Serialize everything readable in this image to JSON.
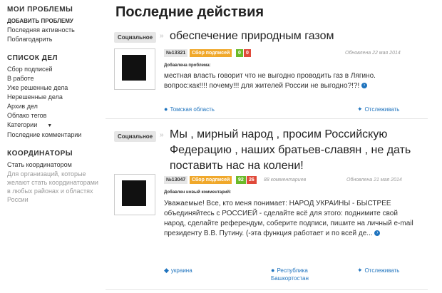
{
  "sidebar": {
    "sections": [
      {
        "heading": "Мои проблемы",
        "links": [
          "добавить проблему",
          "Последняя активность",
          "Поблагодарить"
        ]
      },
      {
        "heading": "Список дел",
        "links": [
          "Сбор подписей",
          "В работе",
          "Уже решенные дела",
          "Нерешенные дела",
          "Архив дел",
          "Облако тегов",
          "Категории",
          "Последние комментарии"
        ]
      },
      {
        "heading": "Координаторы",
        "links": [
          "Стать координатором"
        ],
        "note": "Для организаций, которые желают стать координаторами в любых районах и областях России"
      }
    ]
  },
  "main": {
    "title": "Последние действия",
    "cards": [
      {
        "category": "Социальное",
        "headline": "обеспечение природным газом",
        "number": "№13321",
        "status": "Сбор подписей",
        "votes_up": "0",
        "votes_down": "0",
        "comments": "",
        "date": "Обновлена 22 мая 2014",
        "added_label": "Добавлена проблема:",
        "text": "местная власть говорит что не выгодно проводить газ в Лягино. вопрос:как!!!! почему!!! для жителей России не выгодно?!?!",
        "location_left": "Томская область",
        "location_right": "",
        "track": "Отслеживать"
      },
      {
        "category": "Социальное",
        "headline": "Мы , мирный народ , просим Российскую Федерацию , наших братьев-славян , не дать поставить нас на колени!",
        "number": "№13047",
        "status": "Сбор подписей",
        "votes_up": "92",
        "votes_down": "26",
        "comments": "88 комментариев",
        "date": "Обновлена 21 мая 2014",
        "added_label": "Добавлен новый комментарий:",
        "text": "Уважаемые! Все, кто меня понимает: НАРОД УКРАИНЫ - БЫСТРЕЕ объединяйтесь с РОССИЕЙ - сделайте всё для этого: поднимите свой народ, сделайте референдум, соберите подписи, пишите на личный e-mail президенту В.В. Путину. (-эта функция работает и по всей де...",
        "location_left": "украина",
        "location_right": "Республика Башкортостан",
        "track": "Отслеживать"
      }
    ]
  },
  "colors": {
    "accent": "#1e73be",
    "status_orange": "#f0a82b",
    "vote_green": "#6bba2a",
    "vote_red": "#e04a3a"
  },
  "icons": {
    "pin": "map-pin-icon",
    "tag": "tag-icon",
    "track": "pushpin-icon",
    "more": "arrow-right-circle-icon",
    "arrow": "double-arrow-icon"
  }
}
